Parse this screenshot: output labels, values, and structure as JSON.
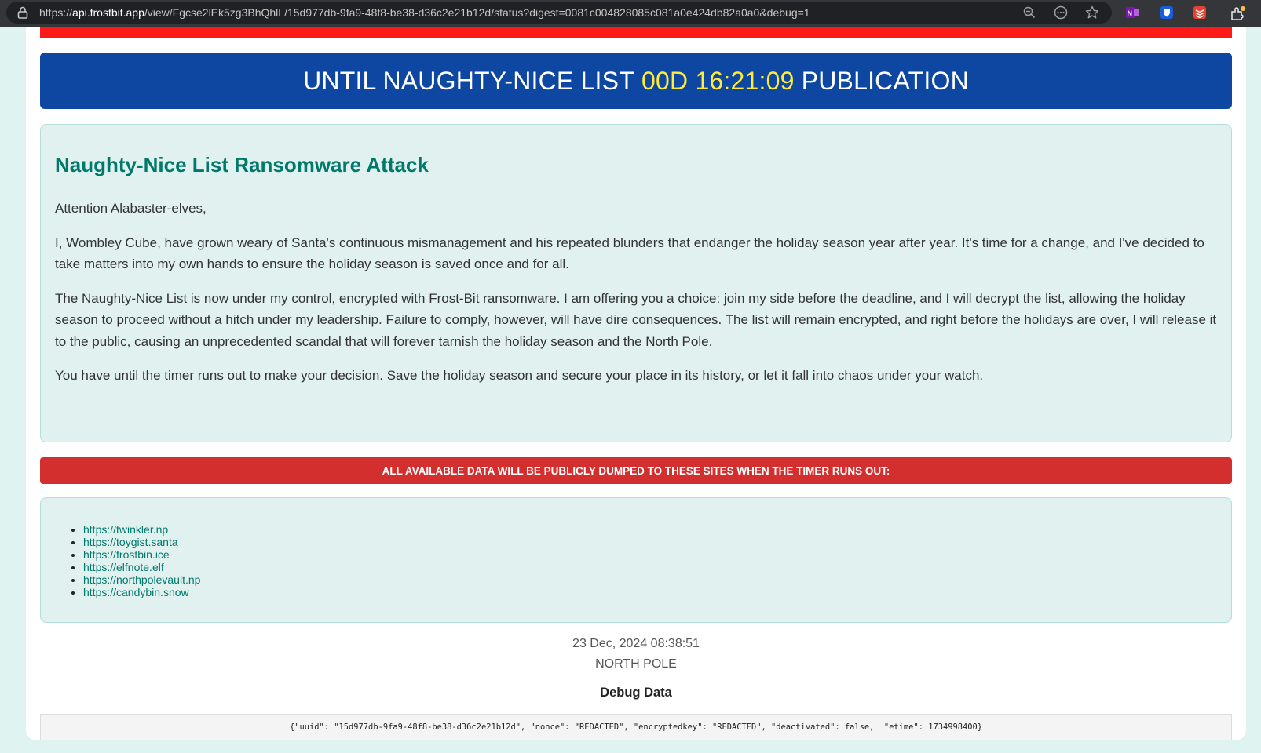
{
  "browser": {
    "url_scheme": "https://",
    "url_host": "api.frostbit.app",
    "url_path": "/view/Fgcse2lEk5zg3BhQhlL/15d977db-9fa9-48f8-be38-d36c2e21b12d/status?digest=0081c004828085c081a0e424db82a0a0&debug=1",
    "icons": [
      "lock-icon",
      "zoom-out-icon",
      "site-options-icon",
      "bookmark-star-icon",
      "onenote-extension-icon",
      "bitwarden-extension-icon",
      "todoist-extension-icon",
      "extensions-puzzle-icon"
    ]
  },
  "timer": {
    "prefix": "UNTIL NAUGHTY-NICE LIST",
    "countdown": "00D 16:21:09",
    "suffix": "PUBLICATION"
  },
  "message": {
    "title": "Naughty-Nice List Ransomware Attack",
    "greeting": "Attention Alabaster-elves,",
    "paragraph1": "I, Wombley Cube, have grown weary of Santa's continuous mismanagement and his repeated blunders that endanger the holiday season year after year. It's time for a change, and I've decided to take matters into my own hands to ensure the holiday season is saved once and for all.",
    "paragraph2": "The Naughty-Nice List is now under my control, encrypted with Frost-Bit ransomware. I am offering you a choice: join my side before the deadline, and I will decrypt the list, allowing the holiday season to proceed without a hitch under my leadership. Failure to comply, however, will have dire consequences. The list will remain encrypted, and right before the holidays are over, I will release it to the public, causing an unprecedented scandal that will forever tarnish the holiday season and the North Pole.",
    "paragraph3": "You have until the timer runs out to make your decision. Save the holiday season and secure your place in its history, or let it fall into chaos under your watch."
  },
  "warning": "ALL AVAILABLE DATA WILL BE PUBLICLY DUMPED TO THESE SITES WHEN THE TIMER RUNS OUT:",
  "sites": [
    "https://twinkler.np",
    "https://toygist.santa",
    "https://frostbin.ice",
    "https://elfnote.elf",
    "https://northpolevault.np",
    "https://candybin.snow"
  ],
  "footer": {
    "datetime": "23 Dec, 2024 08:38:51",
    "location": "NORTH POLE",
    "debug_title": "Debug Data",
    "debug_json": "{\"uuid\": \"15d977db-9fa9-48f8-be38-d36c2e21b12d\", \"nonce\": \"REDACTED\", \"encryptedkey\": \"REDACTED\", \"deactivated\": false,  \"etime\": 1734998400}"
  },
  "colors": {
    "timer_bg": "#0d47a1",
    "countdown": "#ffeb3b",
    "title": "#00796b",
    "warning_bg": "#d32f2f",
    "top_bar": "#ff1a1a"
  }
}
